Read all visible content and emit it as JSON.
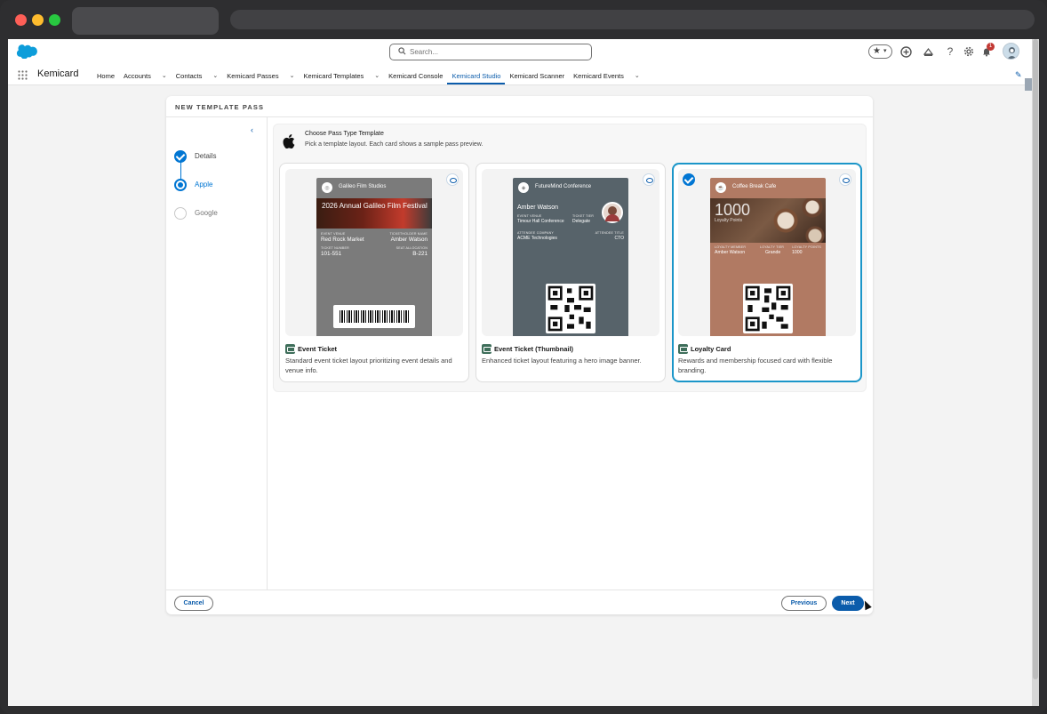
{
  "browser": {
    "window_controls": [
      "close",
      "minimize",
      "maximize"
    ]
  },
  "header": {
    "search_placeholder": "Search...",
    "notification_count": "1",
    "app_name": "Kemicard",
    "nav": [
      {
        "label": "Home",
        "dropdown": false
      },
      {
        "label": "Accounts",
        "dropdown": true
      },
      {
        "label": "Contacts",
        "dropdown": true
      },
      {
        "label": "Kemicard Passes",
        "dropdown": true
      },
      {
        "label": "Kemicard Templates",
        "dropdown": true
      },
      {
        "label": "Kemicard Console",
        "dropdown": false
      },
      {
        "label": "Kemicard Studio",
        "dropdown": false,
        "active": true
      },
      {
        "label": "Kemicard Scanner",
        "dropdown": false
      },
      {
        "label": "Kemicard Events",
        "dropdown": true
      }
    ]
  },
  "modal": {
    "title": "NEW TEMPLATE PASS",
    "steps": [
      {
        "label": "Details",
        "state": "complete"
      },
      {
        "label": "Apple",
        "state": "current"
      },
      {
        "label": "Google",
        "state": "incomplete"
      }
    ],
    "section_title": "Choose Pass Type Template",
    "section_subtitle": "Pick a template layout. Each card shows a sample pass preview.",
    "cards": [
      {
        "name": "Event Ticket",
        "description": "Standard event ticket layout prioritizing event details and venue info.",
        "selected": false,
        "pass": {
          "org": "Galileo Film Studios",
          "hero_text": "2026 Annual Galileo Film Festival",
          "fields": [
            {
              "label": "EVENT VENUE",
              "value": "Red Rock Market"
            },
            {
              "label": "TICKETHOLDER NAME",
              "value": "Amber Watson"
            },
            {
              "label": "TICKET NUMBER",
              "value": "101-551"
            },
            {
              "label": "SEAT ALLOCATION",
              "value": "B-221"
            }
          ],
          "color": "#7b7b7b"
        }
      },
      {
        "name": "Event Ticket (Thumbnail)",
        "description": "Enhanced ticket layout featuring a hero image banner.",
        "selected": false,
        "pass": {
          "org": "FutureMind Conference",
          "holder": "Amber Watson",
          "fields": [
            {
              "label": "EVENT VENUE",
              "value": "Timour Hall Conference"
            },
            {
              "label": "TICKET TIER",
              "value": "Delegate"
            },
            {
              "label": "ATTENDEE COMPANY",
              "value": "ACME Technologies"
            },
            {
              "label": "ATTENDEE TITLE",
              "value": "CTO"
            }
          ],
          "color": "#57636a"
        }
      },
      {
        "name": "Loyalty Card",
        "description": "Rewards and membership focused card with flexible branding.",
        "selected": true,
        "pass": {
          "org": "Coffee Break Cafe",
          "points": "1000",
          "points_label": "Loyalty Points",
          "fields": [
            {
              "label": "LOYALTY MEMBER",
              "value": "Amber Watson"
            },
            {
              "label": "LOYALTY TIER",
              "value": "Grande"
            },
            {
              "label": "LOYALTY POINTS",
              "value": "1000"
            }
          ],
          "color": "#b17a63"
        }
      }
    ],
    "buttons": {
      "cancel": "Cancel",
      "previous": "Previous",
      "next": "Next"
    }
  }
}
